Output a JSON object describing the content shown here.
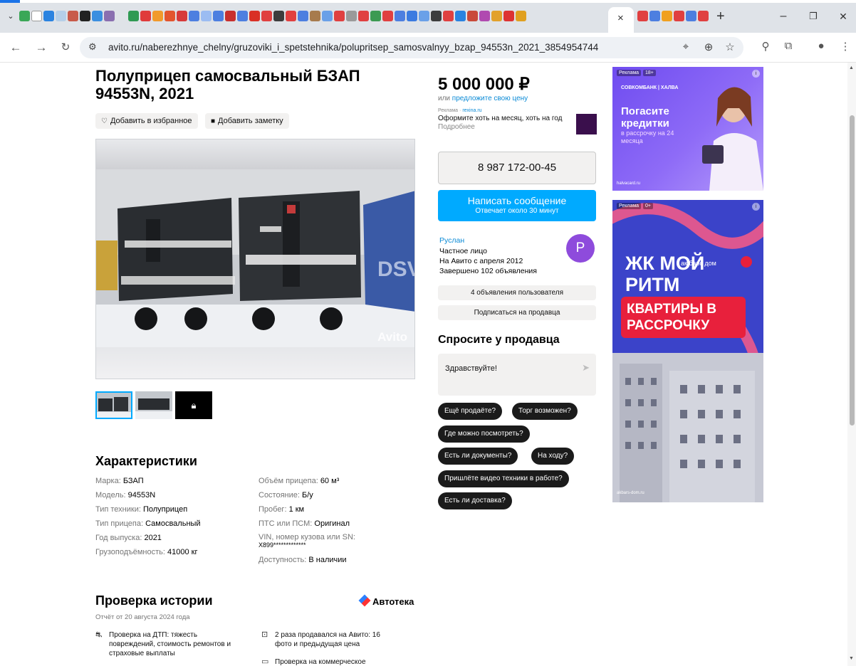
{
  "browser": {
    "tab_close": "×",
    "new_tab": "+",
    "url": "avito.ru/naberezhnye_chelny/gruzoviki_i_spetstehnika/polupritsep_samosvalnyy_bzap_94553n_2021_3854954744",
    "minimize": "–",
    "restore": "❐",
    "close": "✕"
  },
  "listing": {
    "title": "Полуприцеп самосвальный БЗАП 94553N, 2021",
    "favorite_label": "Добавить в избранное",
    "note_label": "Добавить заметку",
    "photo_watermark": "Avito"
  },
  "price": {
    "amount": "5 000 000 ₽",
    "sub_prefix": "или ",
    "sub_link": "предложите свою цену"
  },
  "ad_small": {
    "label": "Реклама · ",
    "domain": "rexina.ru",
    "text": "Оформите хоть на месяц, хоть на год",
    "more": "Подробнее"
  },
  "contact": {
    "phone": "8 987 172-00-45",
    "message_label": "Написать сообщение",
    "message_sub": "Отвечает около 30 минут"
  },
  "seller": {
    "name": "Руслан",
    "type": "Частное лицо",
    "since": "На Авито с апреля 2012",
    "completed": "Завершено 102 объявления",
    "avatar_letter": "P",
    "listings_button": "4 объявления пользователя",
    "subscribe_button": "Подписаться на продавца"
  },
  "ask": {
    "title": "Спросите у продавца",
    "message_value": "Здравствуйте!",
    "chips": [
      "Ещё продаёте?",
      "Торг возможен?",
      "Где можно посмотреть?",
      "Есть ли документы?",
      "На ходу?",
      "Пришлёте видео техники в работе?",
      "Есть ли доставка?"
    ]
  },
  "specs": {
    "title": "Характеристики",
    "left": [
      {
        "k": "Марка: ",
        "v": "БЗАП"
      },
      {
        "k": "Модель: ",
        "v": "94553N"
      },
      {
        "k": "Тип техники: ",
        "v": "Полуприцеп"
      },
      {
        "k": "Тип прицепа: ",
        "v": "Самосвальный"
      },
      {
        "k": "Год выпуска: ",
        "v": "2021"
      },
      {
        "k": "Грузоподъёмность: ",
        "v": "41000 кг"
      }
    ],
    "right": [
      {
        "k": "Объём прицепа: ",
        "v": "60 м³"
      },
      {
        "k": "Состояние: ",
        "v": "Б/у"
      },
      {
        "k": "Пробег: ",
        "v": "1 км"
      },
      {
        "k": "ПТС или ПСМ: ",
        "v": "Оригинал"
      },
      {
        "k": "VIN, номер кузова или SN: ",
        "v": "X899*************"
      },
      {
        "k": "Доступность: ",
        "v": "В наличии"
      }
    ]
  },
  "history": {
    "title": "Проверка истории",
    "subtitle": "Отчёт от 20 августа 2024 года",
    "brand": "Автотека",
    "items": [
      "Проверка на ДТП: тяжесть повреждений, стоимость ремонтов и страховые выплаты",
      "2 раза продавался на Авито: 16 фото и предыдущая цена",
      "Проверка на коммерческое"
    ]
  },
  "banners": {
    "ad_label": "Реклама",
    "b1_age": "18+",
    "b1_brand": "СОВКОМБАНК | ХАЛВА",
    "b1_headline": "Погасите кредитки",
    "b1_sub": "в рассрочку на 24 месяца",
    "b1_foot": "halvacard.ru",
    "b2_age": "0+",
    "b2_headline": "ЖК МОЙ РИТМ",
    "b2_brand": "ак барс дом",
    "b2_red": "КВАРТИРЫ В РАССРОЧКУ",
    "b2_foot": "akbars-dom.ru"
  },
  "colors": {
    "accent": "#00aaff",
    "link": "#0a8ad6",
    "avatar": "#8e4bdc"
  }
}
